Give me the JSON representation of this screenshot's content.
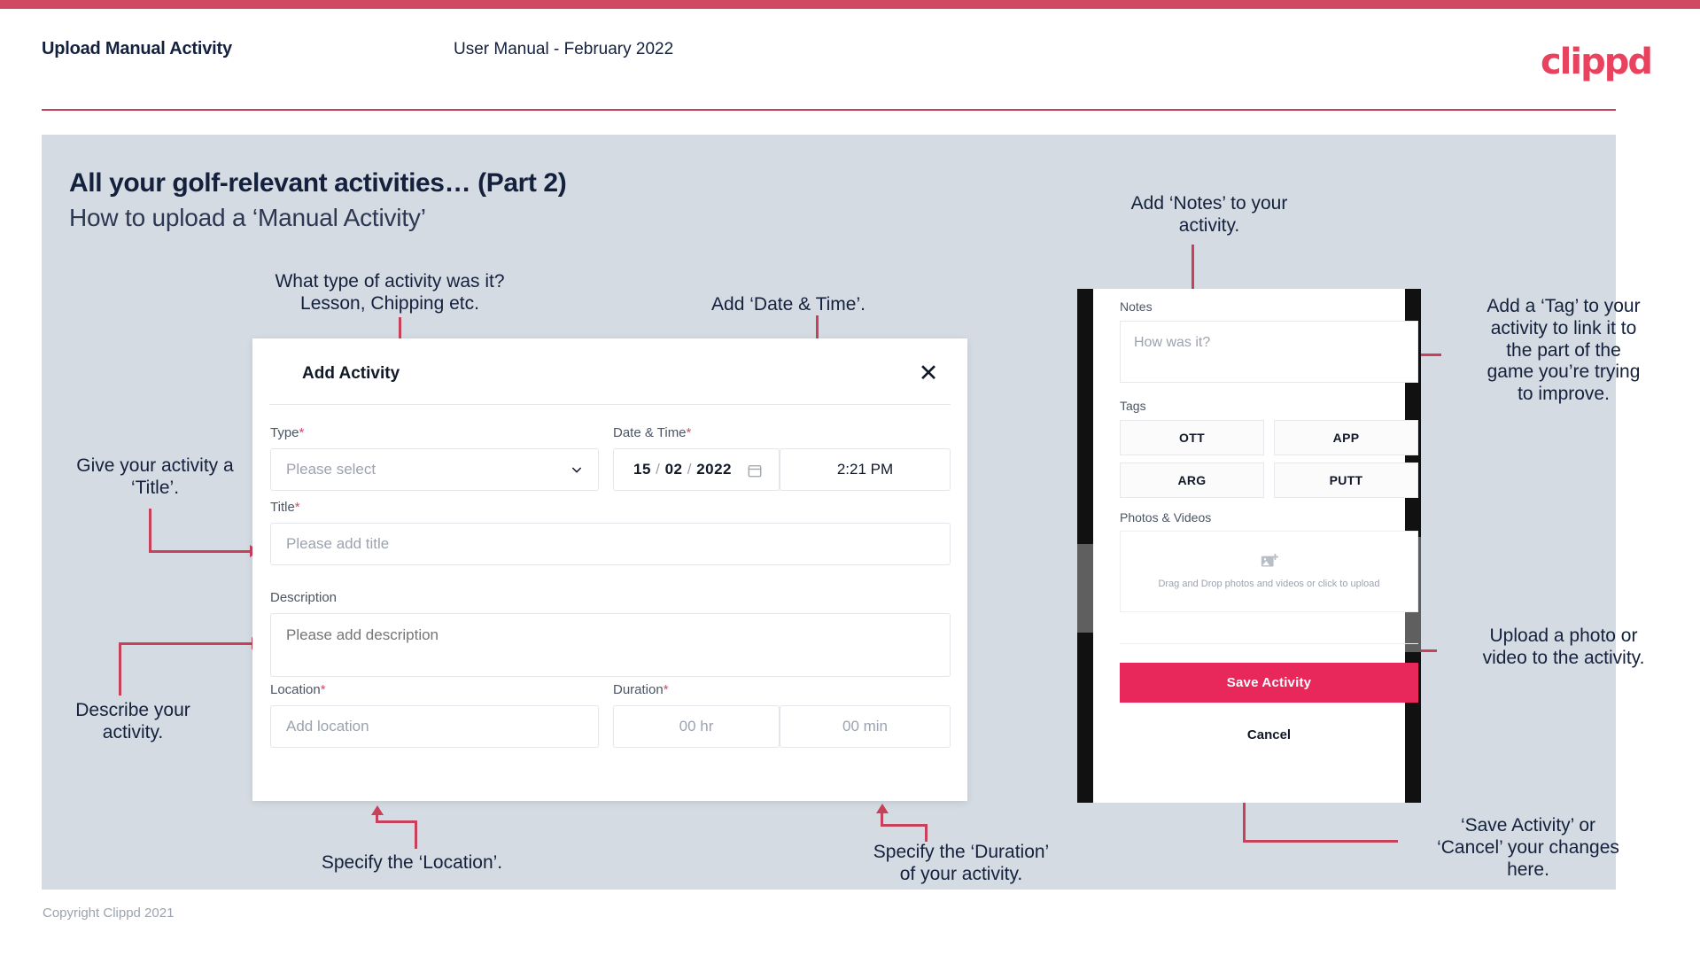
{
  "header": {
    "title": "Upload Manual Activity",
    "subtitle": "User Manual - February 2022",
    "logo": "clippd"
  },
  "slide": {
    "title": "All your golf-relevant activities… (Part 2)",
    "subtitle": "How to upload a ‘Manual Activity’"
  },
  "annotations": {
    "type": "What type of activity was it?\nLesson, Chipping etc.",
    "datetime": "Add ‘Date & Time’.",
    "title": "Give your activity a\n‘Title’.",
    "description": "Describe your\nactivity.",
    "location": "Specify the ‘Location’.",
    "duration": "Specify the ‘Duration’\nof your activity.",
    "notes": "Add ‘Notes’ to your\nactivity.",
    "tags": "Add a ‘Tag’ to your\nactivity to link it to\nthe part of the\ngame you’re trying\nto improve.",
    "upload": "Upload a photo or\nvideo to the activity.",
    "save": "‘Save Activity’ or\n‘Cancel’ your changes\nhere."
  },
  "dialog": {
    "title": "Add Activity",
    "close_icon": "close-icon",
    "fields": {
      "type": {
        "label": "Type",
        "required": "*",
        "placeholder": "Please select"
      },
      "datetime": {
        "label": "Date & Time",
        "required": "*",
        "day": "15",
        "month": "02",
        "year": "2022",
        "time": "2:21 PM"
      },
      "title": {
        "label": "Title",
        "required": "*",
        "placeholder": "Please add title"
      },
      "description": {
        "label": "Description",
        "required": "",
        "placeholder": "Please add description"
      },
      "location": {
        "label": "Location",
        "required": "*",
        "placeholder": "Add location"
      },
      "duration": {
        "label": "Duration",
        "required": "*",
        "hours_placeholder": "00 hr",
        "minutes_placeholder": "00 min"
      }
    }
  },
  "phone": {
    "notes_label": "Notes",
    "notes_placeholder": "How was it?",
    "tags_label": "Tags",
    "tags": [
      "OTT",
      "APP",
      "ARG",
      "PUTT"
    ],
    "photos_label": "Photos & Videos",
    "dropzone_text": "Drag and Drop photos and videos or\nclick to upload",
    "save_label": "Save Activity",
    "cancel_label": "Cancel"
  },
  "footer": {
    "copyright": "Copyright Clippd 2021"
  },
  "colors": {
    "accent": "#c8415a",
    "brand_pink": "#e8425f",
    "save_pink": "#e8275a",
    "slide_bg": "#d5dbe3",
    "text_dark": "#14213d"
  }
}
